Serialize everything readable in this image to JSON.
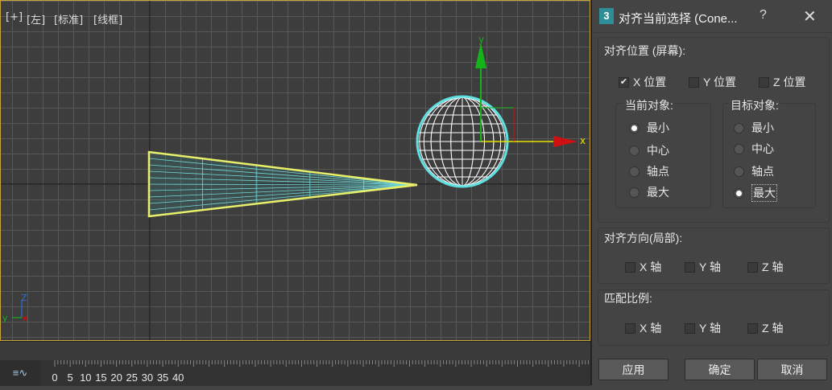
{
  "viewport": {
    "labels": [
      "[+]",
      "[左]",
      "[标准]",
      "[线框]"
    ],
    "x_axis_label": "x",
    "y_axis_label": "y",
    "mini_axis": {
      "z": "Z",
      "y": "y",
      "x": "x"
    }
  },
  "timeline": {
    "icon": "≡∿",
    "ticks": [
      "0",
      "5",
      "10",
      "15",
      "20",
      "25",
      "30",
      "35",
      "40"
    ]
  },
  "dialog": {
    "app_icon": "3",
    "title": "对齐当前选择 (Cone...",
    "help": "?",
    "close": "✕",
    "align_position": {
      "title": "对齐位置 (屏幕):",
      "x": {
        "label": "X 位置",
        "checked": true
      },
      "y": {
        "label": "Y 位置",
        "checked": false
      },
      "z": {
        "label": "Z 位置",
        "checked": false
      },
      "current": {
        "title": "当前对象:",
        "options": [
          "最小",
          "中心",
          "轴点",
          "最大"
        ],
        "selected": "最小"
      },
      "target": {
        "title": "目标对象:",
        "options": [
          "最小",
          "中心",
          "轴点",
          "最大"
        ],
        "selected": "最大"
      }
    },
    "align_orientation": {
      "title": "对齐方向(局部):",
      "x": "X 轴",
      "y": "Y 轴",
      "z": "Z 轴"
    },
    "match_scale": {
      "title": "匹配比例:",
      "x": "X 轴",
      "y": "Y 轴",
      "z": "Z 轴"
    },
    "buttons": {
      "apply": "应用",
      "ok": "确定",
      "cancel": "取消"
    }
  },
  "colors": {
    "accent_cyan": "#5fe0e0",
    "selection_yellow": "#e8ef6a",
    "axis_green": "#16b21a",
    "axis_red": "#d01010",
    "axis_yellow": "#e5e500"
  }
}
